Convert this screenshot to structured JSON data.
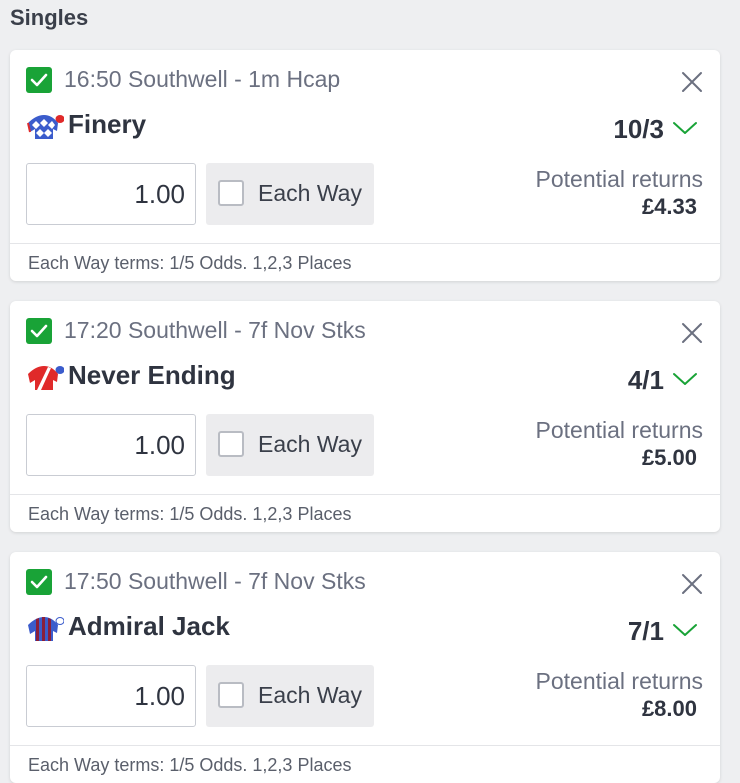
{
  "section": {
    "title": "Singles"
  },
  "bets": [
    {
      "race": "16:50 Southwell - 1m Hcap",
      "runner": "Finery",
      "odds": "10/3",
      "stake": "1.00",
      "each_way_label": "Each Way",
      "each_way_checked": false,
      "returns_label": "Potential returns",
      "returns_value": "£4.33",
      "terms": "Each Way terms: 1/5 Odds. 1,2,3 Places",
      "silks_icon": "silks-blue-white-diamonds-icon"
    },
    {
      "race": "17:20 Southwell - 7f Nov Stks",
      "runner": "Never Ending",
      "odds": "4/1",
      "stake": "1.00",
      "each_way_label": "Each Way",
      "each_way_checked": false,
      "returns_label": "Potential returns",
      "returns_value": "£5.00",
      "terms": "Each Way terms: 1/5 Odds. 1,2,3 Places",
      "silks_icon": "silks-red-white-sash-icon"
    },
    {
      "race": "17:50 Southwell - 7f Nov Stks",
      "runner": "Admiral Jack",
      "odds": "7/1",
      "stake": "1.00",
      "each_way_label": "Each Way",
      "each_way_checked": false,
      "returns_label": "Potential returns",
      "returns_value": "£8.00",
      "terms": "Each Way terms: 1/5 Odds. 1,2,3 Places",
      "silks_icon": "silks-blue-maroon-stripes-icon"
    }
  ],
  "colors": {
    "check_green": "#19a337",
    "chevron_green": "#19a337",
    "background": "#eeeff1",
    "card": "#ffffff"
  }
}
